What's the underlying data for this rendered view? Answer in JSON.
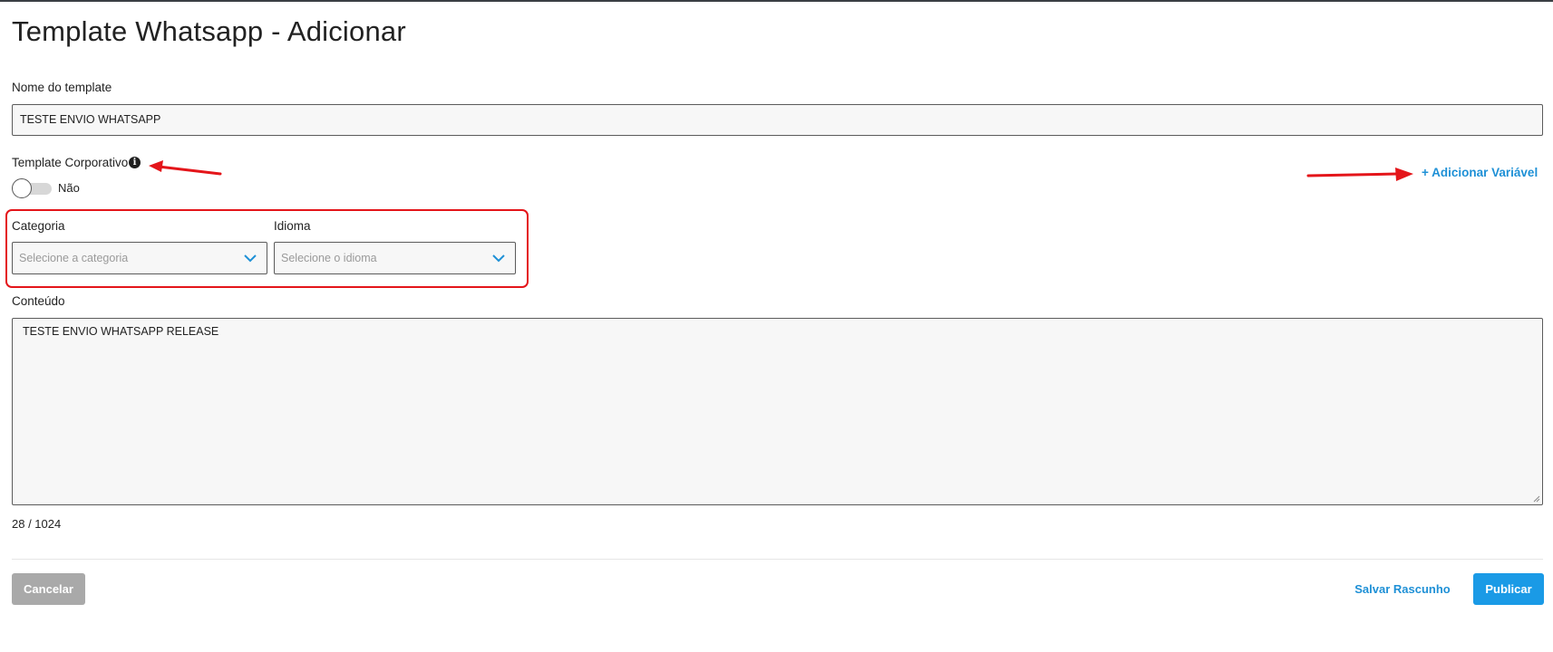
{
  "page": {
    "title": "Template Whatsapp - Adicionar"
  },
  "form": {
    "template_name": {
      "label": "Nome do template",
      "value": "TESTE ENVIO WHATSAPP"
    },
    "corporate": {
      "label": "Template Corporativo",
      "info_icon": "info-icon",
      "toggle_state": false,
      "toggle_label": "Não"
    },
    "add_variable_label": "+ Adicionar Variável",
    "category": {
      "label": "Categoria",
      "placeholder": "Selecione a categoria"
    },
    "language": {
      "label": "Idioma",
      "placeholder": "Selecione o idioma"
    },
    "content": {
      "label": "Conteúdo",
      "value": "TESTE ENVIO WHATSAPP RELEASE"
    },
    "counter": "28 / 1024"
  },
  "actions": {
    "cancel_label": "Cancelar",
    "draft_label": "Salvar Rascunho",
    "publish_label": "Publicar"
  },
  "colors": {
    "accent": "#1e90d6",
    "primary_button": "#1a9ae6",
    "disabled_button": "#a9a9a9",
    "annotation_red": "#e4151a"
  }
}
